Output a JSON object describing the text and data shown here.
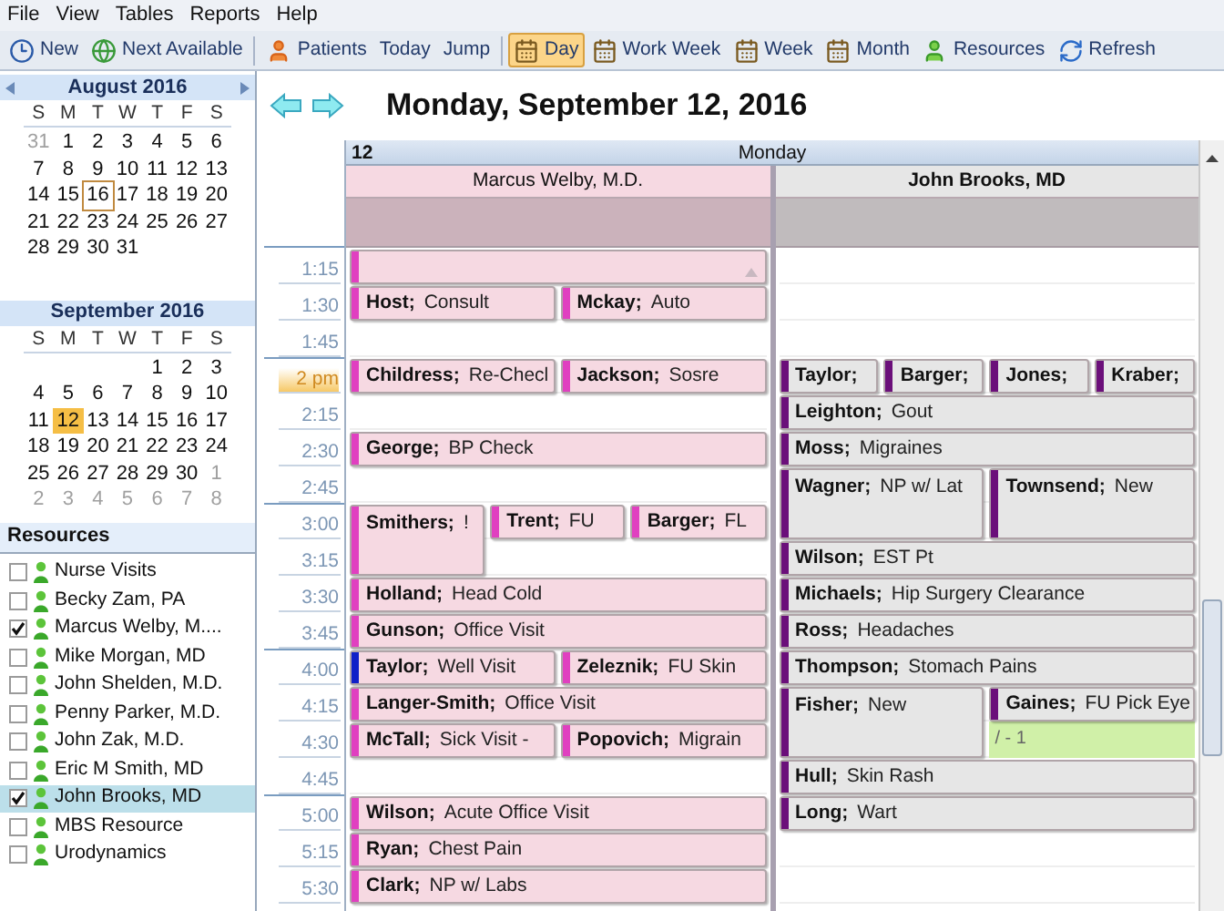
{
  "menu": [
    "File",
    "View",
    "Tables",
    "Reports",
    "Help"
  ],
  "toolbar": [
    {
      "kind": "new",
      "label": "New",
      "selected": false
    },
    {
      "kind": "next",
      "label": "Next Available",
      "selected": false
    },
    {
      "kind": "separator"
    },
    {
      "kind": "patients",
      "label": "Patients",
      "selected": false
    },
    {
      "kind": "plain",
      "label": "Today",
      "selected": false
    },
    {
      "kind": "plain",
      "label": "Jump",
      "selected": false
    },
    {
      "kind": "separator"
    },
    {
      "kind": "calendar",
      "label": "Day",
      "selected": true
    },
    {
      "kind": "calendar",
      "label": "Work Week",
      "selected": false
    },
    {
      "kind": "calendar",
      "label": "Week",
      "selected": false
    },
    {
      "kind": "calendar",
      "label": "Month",
      "selected": false
    },
    {
      "kind": "resources",
      "label": "Resources",
      "selected": false
    },
    {
      "kind": "refresh",
      "label": "Refresh",
      "selected": false
    }
  ],
  "calendars": [
    {
      "title": "August 2016",
      "nav": true,
      "weekdays": [
        "S",
        "M",
        "T",
        "W",
        "T",
        "F",
        "S"
      ],
      "weeks": [
        [
          {
            "d": "31",
            "adjacent": true,
            "selected": false,
            "today": false
          },
          {
            "d": "1",
            "adjacent": false,
            "selected": false,
            "today": false
          },
          {
            "d": "2",
            "adjacent": false,
            "selected": false,
            "today": false
          },
          {
            "d": "3",
            "adjacent": false,
            "selected": false,
            "today": false
          },
          {
            "d": "4",
            "adjacent": false,
            "selected": false,
            "today": false
          },
          {
            "d": "5",
            "adjacent": false,
            "selected": false,
            "today": false
          },
          {
            "d": "6",
            "adjacent": false,
            "selected": false,
            "today": false
          }
        ],
        [
          {
            "d": "7",
            "adjacent": false,
            "selected": false,
            "today": false
          },
          {
            "d": "8",
            "adjacent": false,
            "selected": false,
            "today": false
          },
          {
            "d": "9",
            "adjacent": false,
            "selected": false,
            "today": false
          },
          {
            "d": "10",
            "adjacent": false,
            "selected": false,
            "today": false
          },
          {
            "d": "11",
            "adjacent": false,
            "selected": false,
            "today": false
          },
          {
            "d": "12",
            "adjacent": false,
            "selected": false,
            "today": false
          },
          {
            "d": "13",
            "adjacent": false,
            "selected": false,
            "today": false
          }
        ],
        [
          {
            "d": "14",
            "adjacent": false,
            "selected": false,
            "today": false
          },
          {
            "d": "15",
            "adjacent": false,
            "selected": false,
            "today": false
          },
          {
            "d": "16",
            "adjacent": false,
            "selected": false,
            "today": true
          },
          {
            "d": "17",
            "adjacent": false,
            "selected": false,
            "today": false
          },
          {
            "d": "18",
            "adjacent": false,
            "selected": false,
            "today": false
          },
          {
            "d": "19",
            "adjacent": false,
            "selected": false,
            "today": false
          },
          {
            "d": "20",
            "adjacent": false,
            "selected": false,
            "today": false
          }
        ],
        [
          {
            "d": "21",
            "adjacent": false,
            "selected": false,
            "today": false
          },
          {
            "d": "22",
            "adjacent": false,
            "selected": false,
            "today": false
          },
          {
            "d": "23",
            "adjacent": false,
            "selected": false,
            "today": false
          },
          {
            "d": "24",
            "adjacent": false,
            "selected": false,
            "today": false
          },
          {
            "d": "25",
            "adjacent": false,
            "selected": false,
            "today": false
          },
          {
            "d": "26",
            "adjacent": false,
            "selected": false,
            "today": false
          },
          {
            "d": "27",
            "adjacent": false,
            "selected": false,
            "today": false
          }
        ],
        [
          {
            "d": "28",
            "adjacent": false,
            "selected": false,
            "today": false
          },
          {
            "d": "29",
            "adjacent": false,
            "selected": false,
            "today": false
          },
          {
            "d": "30",
            "adjacent": false,
            "selected": false,
            "today": false
          },
          {
            "d": "31",
            "adjacent": false,
            "selected": false,
            "today": false
          }
        ]
      ]
    },
    {
      "title": "September 2016",
      "nav": false,
      "weekdays": [
        "S",
        "M",
        "T",
        "W",
        "T",
        "F",
        "S"
      ],
      "weeks": [
        [
          {
            "d": "1",
            "adjacent": false,
            "selected": false,
            "today": false
          },
          {
            "d": "2",
            "adjacent": false,
            "selected": false,
            "today": false
          },
          {
            "d": "3",
            "adjacent": false,
            "selected": false,
            "today": false
          }
        ],
        [
          {
            "d": "4",
            "adjacent": false,
            "selected": false,
            "today": false
          },
          {
            "d": "5",
            "adjacent": false,
            "selected": false,
            "today": false
          },
          {
            "d": "6",
            "adjacent": false,
            "selected": false,
            "today": false
          },
          {
            "d": "7",
            "adjacent": false,
            "selected": false,
            "today": false
          },
          {
            "d": "8",
            "adjacent": false,
            "selected": false,
            "today": false
          },
          {
            "d": "9",
            "adjacent": false,
            "selected": false,
            "today": false
          },
          {
            "d": "10",
            "adjacent": false,
            "selected": false,
            "today": false
          }
        ],
        [
          {
            "d": "11",
            "adjacent": false,
            "selected": false,
            "today": false
          },
          {
            "d": "12",
            "adjacent": false,
            "selected": true,
            "today": false
          },
          {
            "d": "13",
            "adjacent": false,
            "selected": false,
            "today": false
          },
          {
            "d": "14",
            "adjacent": false,
            "selected": false,
            "today": false
          },
          {
            "d": "15",
            "adjacent": false,
            "selected": false,
            "today": false
          },
          {
            "d": "16",
            "adjacent": false,
            "selected": false,
            "today": false
          },
          {
            "d": "17",
            "adjacent": false,
            "selected": false,
            "today": false
          }
        ],
        [
          {
            "d": "18",
            "adjacent": false,
            "selected": false,
            "today": false
          },
          {
            "d": "19",
            "adjacent": false,
            "selected": false,
            "today": false
          },
          {
            "d": "20",
            "adjacent": false,
            "selected": false,
            "today": false
          },
          {
            "d": "21",
            "adjacent": false,
            "selected": false,
            "today": false
          },
          {
            "d": "22",
            "adjacent": false,
            "selected": false,
            "today": false
          },
          {
            "d": "23",
            "adjacent": false,
            "selected": false,
            "today": false
          },
          {
            "d": "24",
            "adjacent": false,
            "selected": false,
            "today": false
          }
        ],
        [
          {
            "d": "25",
            "adjacent": false,
            "selected": false,
            "today": false
          },
          {
            "d": "26",
            "adjacent": false,
            "selected": false,
            "today": false
          },
          {
            "d": "27",
            "adjacent": false,
            "selected": false,
            "today": false
          },
          {
            "d": "28",
            "adjacent": false,
            "selected": false,
            "today": false
          },
          {
            "d": "29",
            "adjacent": false,
            "selected": false,
            "today": false
          },
          {
            "d": "30",
            "adjacent": false,
            "selected": false,
            "today": false
          },
          {
            "d": "1",
            "adjacent": true,
            "selected": false,
            "today": false
          }
        ],
        [
          {
            "d": "2",
            "adjacent": true,
            "selected": false,
            "today": false
          },
          {
            "d": "3",
            "adjacent": true,
            "selected": false,
            "today": false
          },
          {
            "d": "4",
            "adjacent": true,
            "selected": false,
            "today": false
          },
          {
            "d": "5",
            "adjacent": true,
            "selected": false,
            "today": false
          },
          {
            "d": "6",
            "adjacent": true,
            "selected": false,
            "today": false
          },
          {
            "d": "7",
            "adjacent": true,
            "selected": false,
            "today": false
          },
          {
            "d": "8",
            "adjacent": true,
            "selected": false,
            "today": false
          }
        ]
      ]
    }
  ],
  "resources": {
    "title": "Resources",
    "items": [
      {
        "name": "Nurse Visits",
        "checked": false,
        "selected": false
      },
      {
        "name": "Becky Zam, PA",
        "checked": false,
        "selected": false
      },
      {
        "name": "Marcus Welby, M....",
        "checked": true,
        "selected": false
      },
      {
        "name": "Mike Morgan, MD",
        "checked": false,
        "selected": false
      },
      {
        "name": "John Shelden, M.D.",
        "checked": false,
        "selected": false
      },
      {
        "name": "Penny Parker, M.D.",
        "checked": false,
        "selected": false
      },
      {
        "name": "John Zak, M.D.",
        "checked": false,
        "selected": false
      },
      {
        "name": "Eric M Smith, MD",
        "checked": false,
        "selected": false
      },
      {
        "name": "John Brooks, MD",
        "checked": true,
        "selected": true
      },
      {
        "name": "MBS Resource",
        "checked": false,
        "selected": false
      },
      {
        "name": "Urodynamics",
        "checked": false,
        "selected": false
      }
    ]
  },
  "date_title": "Monday, September 12, 2016",
  "day_header": {
    "day": "12",
    "weekday": "Monday"
  },
  "slots": [
    {
      "time": "1:15",
      "kind": "quarter",
      "now": false
    },
    {
      "time": "1:30",
      "kind": "quarter",
      "now": false
    },
    {
      "time": "1:45",
      "kind": "quarter",
      "now": false
    },
    {
      "time": "2 pm",
      "kind": "hour",
      "now": true
    },
    {
      "time": "2:15",
      "kind": "quarter",
      "now": false
    },
    {
      "time": "2:30",
      "kind": "quarter",
      "now": false
    },
    {
      "time": "2:45",
      "kind": "quarter",
      "now": false
    },
    {
      "time": "3:00",
      "kind": "hour",
      "now": false
    },
    {
      "time": "3:15",
      "kind": "quarter",
      "now": false
    },
    {
      "time": "3:30",
      "kind": "quarter",
      "now": false
    },
    {
      "time": "3:45",
      "kind": "quarter",
      "now": false
    },
    {
      "time": "4:00",
      "kind": "hour",
      "now": false
    },
    {
      "time": "4:15",
      "kind": "quarter",
      "now": false
    },
    {
      "time": "4:30",
      "kind": "quarter",
      "now": false
    },
    {
      "time": "4:45",
      "kind": "quarter",
      "now": false
    },
    {
      "time": "5:00",
      "kind": "hour",
      "now": false
    },
    {
      "time": "5:15",
      "kind": "quarter",
      "now": false
    },
    {
      "time": "5:30",
      "kind": "quarter",
      "now": false
    }
  ],
  "columns": [
    {
      "name": "Marcus Welby, M.D.",
      "selected": false,
      "color": "#f6d9e2",
      "rows": [
        {
          "kind": "booked",
          "appointments": [
            {
              "kind": "short",
              "color": "#e040c0"
            }
          ]
        },
        {
          "kind": "booked",
          "appointments": [
            {
              "patient": "Host;",
              "reason": "Consult",
              "kind": "short",
              "color": "#e040c0"
            },
            {
              "patient": "Mckay;",
              "reason": "Auto",
              "kind": "short",
              "color": "#e040c0"
            }
          ]
        },
        {
          "kind": "free"
        },
        {
          "kind": "booked",
          "appointments": [
            {
              "patient": "Childress;",
              "reason": "Re-Checl",
              "kind": "short",
              "color": "#e040c0"
            },
            {
              "patient": "Jackson;",
              "reason": "Sosre",
              "kind": "short",
              "color": "#e040c0"
            }
          ]
        },
        {
          "kind": "free"
        },
        {
          "kind": "booked",
          "appointments": [
            {
              "patient": "George;",
              "reason": "BP Check",
              "kind": "short",
              "color": "#e040c0"
            }
          ]
        },
        {
          "kind": "free"
        },
        {
          "kind": "booked",
          "appointments": [
            {
              "patient": "Smithers;",
              "reason": "!",
              "kind": "long",
              "color": "#e040c0"
            },
            {
              "patient": "Trent;",
              "reason": "FU",
              "kind": "short",
              "color": "#e040c0"
            },
            {
              "patient": "Barger;",
              "reason": "FL",
              "kind": "short",
              "color": "#e040c0"
            }
          ]
        },
        {
          "kind": "continued"
        },
        {
          "kind": "booked",
          "appointments": [
            {
              "patient": "Holland;",
              "reason": "Head Cold",
              "kind": "short",
              "color": "#e040c0"
            }
          ]
        },
        {
          "kind": "booked",
          "appointments": [
            {
              "patient": "Gunson;",
              "reason": "Office Visit",
              "kind": "short",
              "color": "#e040c0"
            }
          ]
        },
        {
          "kind": "booked",
          "appointments": [
            {
              "patient": "Taylor;",
              "reason": "Well Visit",
              "kind": "short",
              "color": "#1020c8"
            },
            {
              "patient": "Zeleznik;",
              "reason": "FU Skin",
              "kind": "short",
              "color": "#e040c0"
            }
          ]
        },
        {
          "kind": "booked",
          "appointments": [
            {
              "patient": "Langer-Smith;",
              "reason": "Office Visit",
              "kind": "short",
              "color": "#e040c0"
            }
          ]
        },
        {
          "kind": "booked",
          "appointments": [
            {
              "patient": "McTall;",
              "reason": "Sick Visit -",
              "kind": "short",
              "color": "#e040c0"
            },
            {
              "patient": "Popovich;",
              "reason": "Migrain",
              "kind": "short",
              "color": "#e040c0"
            }
          ]
        },
        {
          "kind": "free"
        },
        {
          "kind": "booked",
          "appointments": [
            {
              "patient": "Wilson;",
              "reason": "Acute Office Visit",
              "kind": "short",
              "color": "#e040c0"
            }
          ]
        },
        {
          "kind": "booked",
          "appointments": [
            {
              "patient": "Ryan;",
              "reason": "Chest Pain",
              "kind": "short",
              "color": "#e040c0"
            }
          ]
        },
        {
          "kind": "booked",
          "appointments": [
            {
              "patient": "Clark;",
              "reason": "NP w/ Labs",
              "kind": "short",
              "color": "#e040c0"
            }
          ]
        }
      ]
    },
    {
      "name": "John Brooks, MD",
      "selected": true,
      "color": "#e6e6e6",
      "rows": [
        {
          "kind": "free"
        },
        {
          "kind": "free"
        },
        {
          "kind": "free"
        },
        {
          "kind": "booked",
          "appointments": [
            {
              "patient": "Taylor;",
              "kind": "short",
              "color": "#6b0f7a"
            },
            {
              "patient": "Barger;",
              "kind": "short",
              "color": "#6b0f7a"
            },
            {
              "patient": "Jones;",
              "kind": "short",
              "color": "#6b0f7a"
            },
            {
              "patient": "Kraber;",
              "kind": "short",
              "color": "#6b0f7a"
            }
          ]
        },
        {
          "kind": "booked",
          "appointments": [
            {
              "patient": "Leighton;",
              "reason": "Gout",
              "kind": "short",
              "color": "#6b0f7a"
            }
          ]
        },
        {
          "kind": "booked",
          "appointments": [
            {
              "patient": "Moss;",
              "reason": "Migraines",
              "kind": "short",
              "color": "#6b0f7a"
            }
          ]
        },
        {
          "kind": "booked",
          "appointments": [
            {
              "patient": "Wagner;",
              "reason": "NP w/ Lat",
              "kind": "long",
              "color": "#6b0f7a"
            },
            {
              "patient": "Townsend;",
              "reason": "New",
              "kind": "long",
              "color": "#6b0f7a"
            }
          ]
        },
        {
          "kind": "continued"
        },
        {
          "kind": "booked",
          "appointments": [
            {
              "patient": "Wilson;",
              "reason": "EST Pt",
              "kind": "short",
              "color": "#6b0f7a"
            }
          ]
        },
        {
          "kind": "booked",
          "appointments": [
            {
              "patient": "Michaels;",
              "reason": "Hip Surgery Clearance",
              "kind": "short",
              "color": "#6b0f7a"
            }
          ]
        },
        {
          "kind": "booked",
          "appointments": [
            {
              "patient": "Ross;",
              "reason": "Headaches",
              "kind": "short",
              "color": "#6b0f7a"
            }
          ]
        },
        {
          "kind": "booked",
          "appointments": [
            {
              "patient": "Thompson;",
              "reason": "Stomach Pains",
              "kind": "short",
              "color": "#6b0f7a"
            }
          ]
        },
        {
          "kind": "booked",
          "appointments": [
            {
              "patient": "Fisher;",
              "reason": "New",
              "kind": "long",
              "color": "#6b0f7a"
            },
            {
              "patient": "Gaines;",
              "reason": "FU Pick Eye",
              "kind": "short",
              "color": "#6b0f7a",
              "note": "/ - 1"
            }
          ]
        },
        {
          "kind": "continued"
        },
        {
          "kind": "booked",
          "appointments": [
            {
              "patient": "Hull;",
              "reason": "Skin Rash",
              "kind": "short",
              "color": "#6b0f7a"
            }
          ]
        },
        {
          "kind": "booked",
          "appointments": [
            {
              "patient": "Long;",
              "reason": "Wart",
              "kind": "short",
              "color": "#6b0f7a"
            }
          ]
        },
        {
          "kind": "free"
        },
        {
          "kind": "free"
        }
      ]
    }
  ]
}
